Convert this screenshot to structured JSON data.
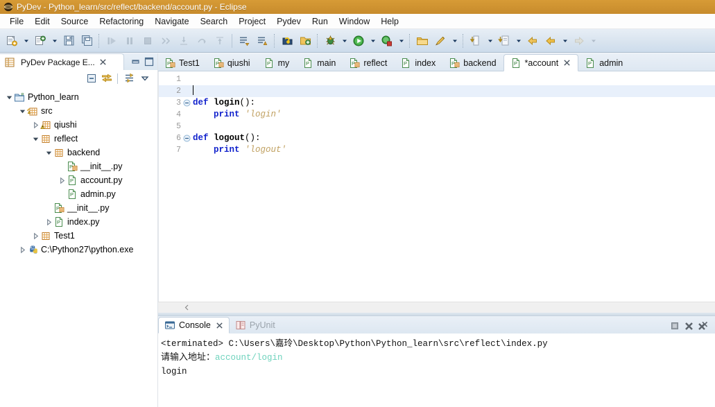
{
  "window": {
    "title": "PyDev - Python_learn/src/reflect/backend/account.py - Eclipse",
    "app_icon": "pydev-globe-icon"
  },
  "menubar": {
    "items": [
      {
        "label": "File"
      },
      {
        "label": "Edit"
      },
      {
        "label": "Source"
      },
      {
        "label": "Refactoring"
      },
      {
        "label": "Navigate"
      },
      {
        "label": "Search"
      },
      {
        "label": "Project"
      },
      {
        "label": "Pydev"
      },
      {
        "label": "Run"
      },
      {
        "label": "Window"
      },
      {
        "label": "Help"
      }
    ]
  },
  "toolbar": {
    "groups": [
      {
        "buttons": [
          {
            "name": "new-wizard-button",
            "icon": "new-file-icon",
            "enabled": true,
            "dropdown": true
          },
          {
            "name": "new-pydev-project-button",
            "icon": "new-project-icon",
            "enabled": true,
            "dropdown": true
          },
          {
            "name": "save-button",
            "icon": "save-icon",
            "enabled": true
          },
          {
            "name": "save-all-button",
            "icon": "save-all-icon",
            "enabled": true
          }
        ]
      },
      {
        "buttons": [
          {
            "name": "resume-button",
            "icon": "resume-icon",
            "enabled": false
          },
          {
            "name": "suspend-button",
            "icon": "suspend-icon",
            "enabled": false
          },
          {
            "name": "terminate-button",
            "icon": "terminate-icon",
            "enabled": false
          },
          {
            "name": "disconnect-button",
            "icon": "disconnect-icon",
            "enabled": false
          },
          {
            "name": "step-into-button",
            "icon": "step-into-icon",
            "enabled": false
          },
          {
            "name": "step-over-button",
            "icon": "step-over-icon",
            "enabled": false
          },
          {
            "name": "step-return-button",
            "icon": "step-return-icon",
            "enabled": false
          }
        ]
      },
      {
        "buttons": [
          {
            "name": "next-annotation-button",
            "icon": "next-annotation-icon",
            "enabled": true
          },
          {
            "name": "previous-annotation-button",
            "icon": "previous-annotation-icon",
            "enabled": true
          }
        ]
      },
      {
        "buttons": [
          {
            "name": "open-python-module-button",
            "icon": "python-module-icon",
            "enabled": true
          },
          {
            "name": "open-resource-button",
            "icon": "open-folder-icon",
            "enabled": true
          }
        ]
      },
      {
        "buttons": [
          {
            "name": "debug-button",
            "icon": "debug-bug-icon",
            "enabled": true,
            "dropdown": true
          },
          {
            "name": "run-button",
            "icon": "run-play-icon",
            "enabled": true,
            "dropdown": true
          },
          {
            "name": "external-tools-button",
            "icon": "external-tools-icon",
            "enabled": true,
            "dropdown": true
          }
        ]
      },
      {
        "buttons": [
          {
            "name": "open-task-button",
            "icon": "task-folder-icon",
            "enabled": true
          },
          {
            "name": "search-button",
            "icon": "search-pencil-icon",
            "enabled": true,
            "dropdown": true
          }
        ]
      },
      {
        "buttons": [
          {
            "name": "pin-editor-button",
            "icon": "pin-icon",
            "enabled": true,
            "dropdown": true
          },
          {
            "name": "last-edit-location-button",
            "icon": "last-edit-icon",
            "enabled": true,
            "dropdown": true
          }
        ]
      },
      {
        "buttons": [
          {
            "name": "back-button",
            "icon": "back-arrow-icon",
            "enabled": true
          },
          {
            "name": "forward-button",
            "icon": "forward-arrow-icon",
            "enabled": true,
            "dropdown": true
          },
          {
            "name": "next-button",
            "icon": "next-arrow-icon",
            "enabled": false,
            "dropdown": true
          }
        ]
      }
    ]
  },
  "explorer": {
    "tab_label": "PyDev Package E...",
    "tab_icon": "pydev-package-explorer-icon",
    "close_icon": "close-icon",
    "minimize_icon": "minimize-icon",
    "maximize_icon": "maximize-icon",
    "toolbar": [
      {
        "name": "collapse-all-button",
        "icon": "collapse-all-icon"
      },
      {
        "name": "link-with-editor-button",
        "icon": "link-editor-icon"
      },
      {
        "name": "filters-button",
        "icon": "filters-icon"
      },
      {
        "name": "view-menu-button",
        "icon": "chevron-down-icon"
      }
    ],
    "tree": [
      {
        "label": "Python_learn",
        "depth": 0,
        "twisty": "expanded",
        "icon": "project-icon"
      },
      {
        "label": "src",
        "depth": 1,
        "twisty": "expanded",
        "icon": "source-folder-icon"
      },
      {
        "label": "qiushi",
        "depth": 2,
        "twisty": "collapsed",
        "icon": "package-warn-icon"
      },
      {
        "label": "reflect",
        "depth": 2,
        "twisty": "expanded",
        "icon": "package-icon"
      },
      {
        "label": "backend",
        "depth": 3,
        "twisty": "expanded",
        "icon": "package-icon"
      },
      {
        "label": "__init__.py",
        "depth": 4,
        "twisty": "none",
        "icon": "init-py-icon"
      },
      {
        "label": "account.py",
        "depth": 4,
        "twisty": "collapsed",
        "icon": "py-file-icon"
      },
      {
        "label": "admin.py",
        "depth": 4,
        "twisty": "none",
        "icon": "py-file-icon"
      },
      {
        "label": "__init__.py",
        "depth": 3,
        "twisty": "none",
        "icon": "init-py-icon"
      },
      {
        "label": "index.py",
        "depth": 3,
        "twisty": "collapsed",
        "icon": "py-file-icon"
      },
      {
        "label": "Test1",
        "depth": 2,
        "twisty": "collapsed",
        "icon": "package-icon"
      },
      {
        "label": "C:\\Python27\\python.exe",
        "depth": 1,
        "twisty": "collapsed",
        "icon": "python-interpreter-icon"
      }
    ]
  },
  "editor": {
    "tabs": [
      {
        "label": "Test1",
        "icon": "init-py-icon",
        "active": false,
        "dirty": false
      },
      {
        "label": "qiushi",
        "icon": "init-py-icon",
        "active": false,
        "dirty": false
      },
      {
        "label": "my",
        "icon": "py-file-icon",
        "active": false,
        "dirty": false
      },
      {
        "label": "main",
        "icon": "py-file-icon",
        "active": false,
        "dirty": false
      },
      {
        "label": "reflect",
        "icon": "init-py-icon",
        "active": false,
        "dirty": false
      },
      {
        "label": "index",
        "icon": "py-file-icon",
        "active": false,
        "dirty": false
      },
      {
        "label": "backend",
        "icon": "init-py-icon",
        "active": false,
        "dirty": false
      },
      {
        "label": "*account",
        "icon": "py-file-icon",
        "active": true,
        "dirty": true
      },
      {
        "label": "admin",
        "icon": "py-file-icon",
        "active": false,
        "dirty": false
      }
    ],
    "close_icon": "close-icon",
    "current_line": 2,
    "lines": [
      {
        "no": "1",
        "fold": false,
        "current": false,
        "tokens": []
      },
      {
        "no": "2",
        "fold": false,
        "current": true,
        "tokens": [],
        "caret": true
      },
      {
        "no": "3",
        "fold": true,
        "current": false,
        "tokens": [
          {
            "t": "def",
            "c": "kw"
          },
          {
            "t": " ",
            "c": "pn"
          },
          {
            "t": "login",
            "c": "fn"
          },
          {
            "t": "():",
            "c": "pn"
          }
        ]
      },
      {
        "no": "4",
        "fold": false,
        "current": false,
        "tokens": [
          {
            "t": "    ",
            "c": "pn"
          },
          {
            "t": "print",
            "c": "kw"
          },
          {
            "t": " ",
            "c": "pn"
          },
          {
            "t": "'login'",
            "c": "str"
          }
        ]
      },
      {
        "no": "5",
        "fold": false,
        "current": false,
        "tokens": []
      },
      {
        "no": "6",
        "fold": true,
        "current": false,
        "tokens": [
          {
            "t": "def",
            "c": "kw"
          },
          {
            "t": " ",
            "c": "pn"
          },
          {
            "t": "logout",
            "c": "fn"
          },
          {
            "t": "():",
            "c": "pn"
          }
        ]
      },
      {
        "no": "7",
        "fold": false,
        "current": false,
        "tokens": [
          {
            "t": "    ",
            "c": "pn"
          },
          {
            "t": "print",
            "c": "kw"
          },
          {
            "t": " ",
            "c": "pn"
          },
          {
            "t": "'logout'",
            "c": "str"
          }
        ]
      }
    ],
    "scroll_left_icon": "scroll-left-icon"
  },
  "console": {
    "tabs": [
      {
        "label": "Console",
        "icon": "console-icon",
        "active": true,
        "closable": true
      },
      {
        "label": "PyUnit",
        "icon": "pyunit-icon",
        "active": false,
        "closable": false
      }
    ],
    "close_icon": "close-icon",
    "tools": [
      {
        "name": "terminate-console-button",
        "icon": "terminate-icon"
      },
      {
        "name": "remove-launch-button",
        "icon": "remove-x-icon"
      },
      {
        "name": "remove-all-terminated-button",
        "icon": "remove-all-x-icon"
      }
    ],
    "output": [
      {
        "kind": "terminated",
        "text": "<terminated> C:\\Users\\嘉玲\\Desktop\\Python\\Python_learn\\src\\reflect\\index.py"
      },
      {
        "kind": "prompt",
        "prompt": "请输入地址：",
        "input": "account/login"
      },
      {
        "kind": "stdout",
        "text": "login"
      }
    ]
  },
  "colors": {
    "title_bar": "#cf9331",
    "toolbar_top": "#e7eef6",
    "keyword": "#1122cc",
    "string": "#c0a060",
    "console_input": "#6fd3bd",
    "current_line": "#e8f0fb"
  }
}
